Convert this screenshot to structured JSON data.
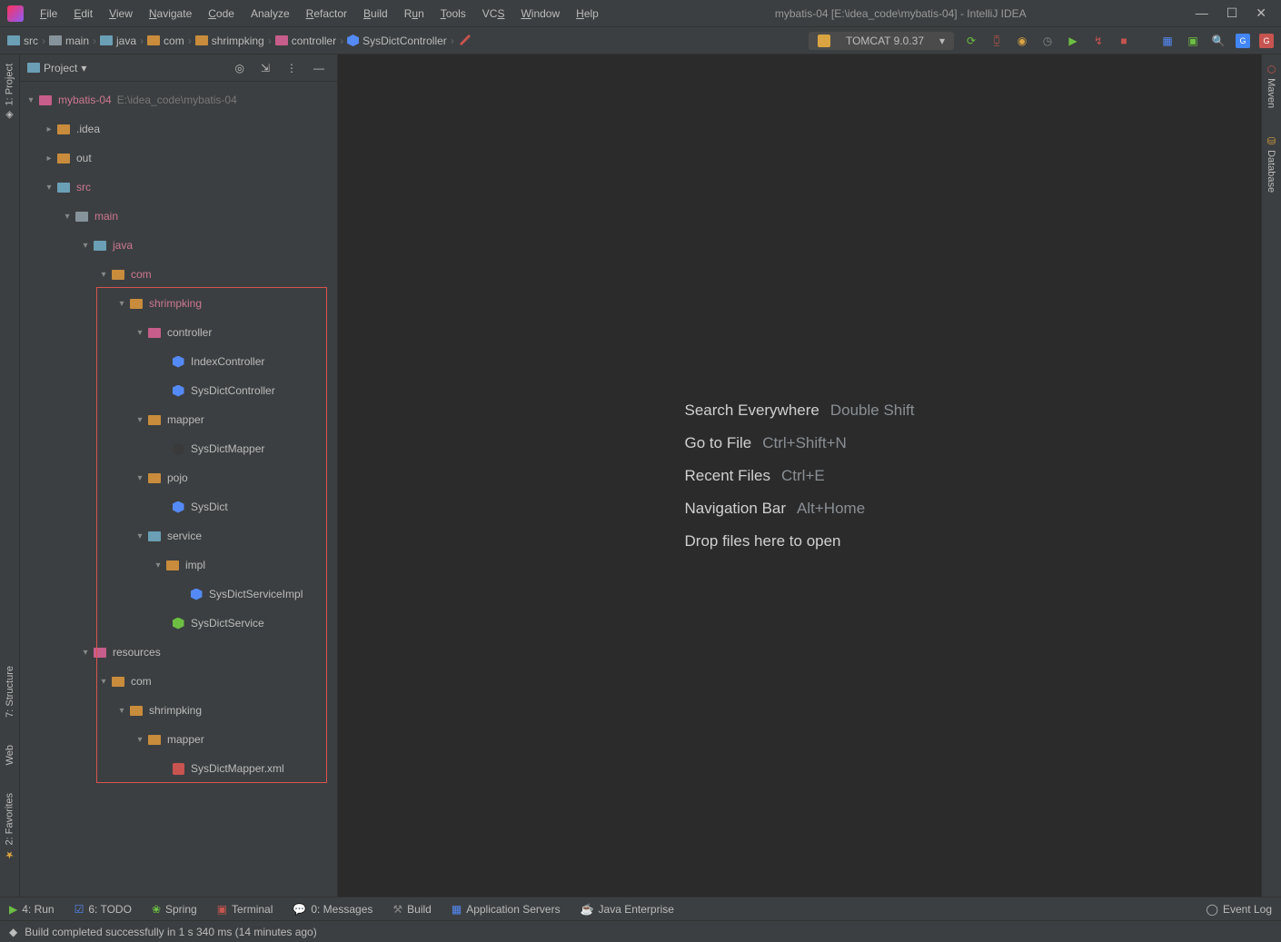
{
  "window": {
    "title": "mybatis-04 [E:\\idea_code\\mybatis-04] - IntelliJ IDEA"
  },
  "menu": {
    "file": "File",
    "edit": "Edit",
    "view": "View",
    "navigate": "Navigate",
    "code": "Code",
    "analyze": "Analyze",
    "refactor": "Refactor",
    "build": "Build",
    "run": "Run",
    "tools": "Tools",
    "vcs": "VCS",
    "window": "Window",
    "help": "Help"
  },
  "breadcrumb": {
    "items": [
      "src",
      "main",
      "java",
      "com",
      "shrimpking",
      "controller",
      "SysDictController"
    ]
  },
  "run_config": {
    "label": "TOMCAT 9.0.37"
  },
  "project_panel": {
    "title": "Project"
  },
  "tree": {
    "root": {
      "label": "mybatis-04",
      "path": "E:\\idea_code\\mybatis-04"
    },
    "idea": ".idea",
    "out": "out",
    "src": "src",
    "main": "main",
    "java": "java",
    "com": "com",
    "shrimpking": "shrimpking",
    "controller": "controller",
    "indexcontroller": "IndexController",
    "sysdictcontroller": "SysDictController",
    "mapper": "mapper",
    "sysdictmapper": "SysDictMapper",
    "pojo": "pojo",
    "sysdict": "SysDict",
    "service": "service",
    "impl": "impl",
    "sysdictserviceimpl": "SysDictServiceImpl",
    "sysdictservice": "SysDictService",
    "resources": "resources",
    "res_com": "com",
    "res_shrimpking": "shrimpking",
    "res_mapper": "mapper",
    "sysdictmapperxml": "SysDictMapper.xml"
  },
  "left_tools": {
    "project": "1: Project",
    "structure": "7: Structure",
    "web": "Web",
    "favorites": "2: Favorites"
  },
  "right_tools": {
    "maven": "Maven",
    "database": "Database"
  },
  "welcome": {
    "search": "Search Everywhere",
    "search_key": "Double Shift",
    "gotofile": "Go to File",
    "gotofile_key": "Ctrl+Shift+N",
    "recent": "Recent Files",
    "recent_key": "Ctrl+E",
    "navbar": "Navigation Bar",
    "navbar_key": "Alt+Home",
    "drop": "Drop files here to open"
  },
  "bottom_tools": {
    "run": "4: Run",
    "todo": "6: TODO",
    "spring": "Spring",
    "terminal": "Terminal",
    "messages": "0: Messages",
    "build": "Build",
    "appservers": "Application Servers",
    "javaee": "Java Enterprise",
    "eventlog": "Event Log"
  },
  "status": {
    "message": "Build completed successfully in 1 s 340 ms (14 minutes ago)"
  }
}
